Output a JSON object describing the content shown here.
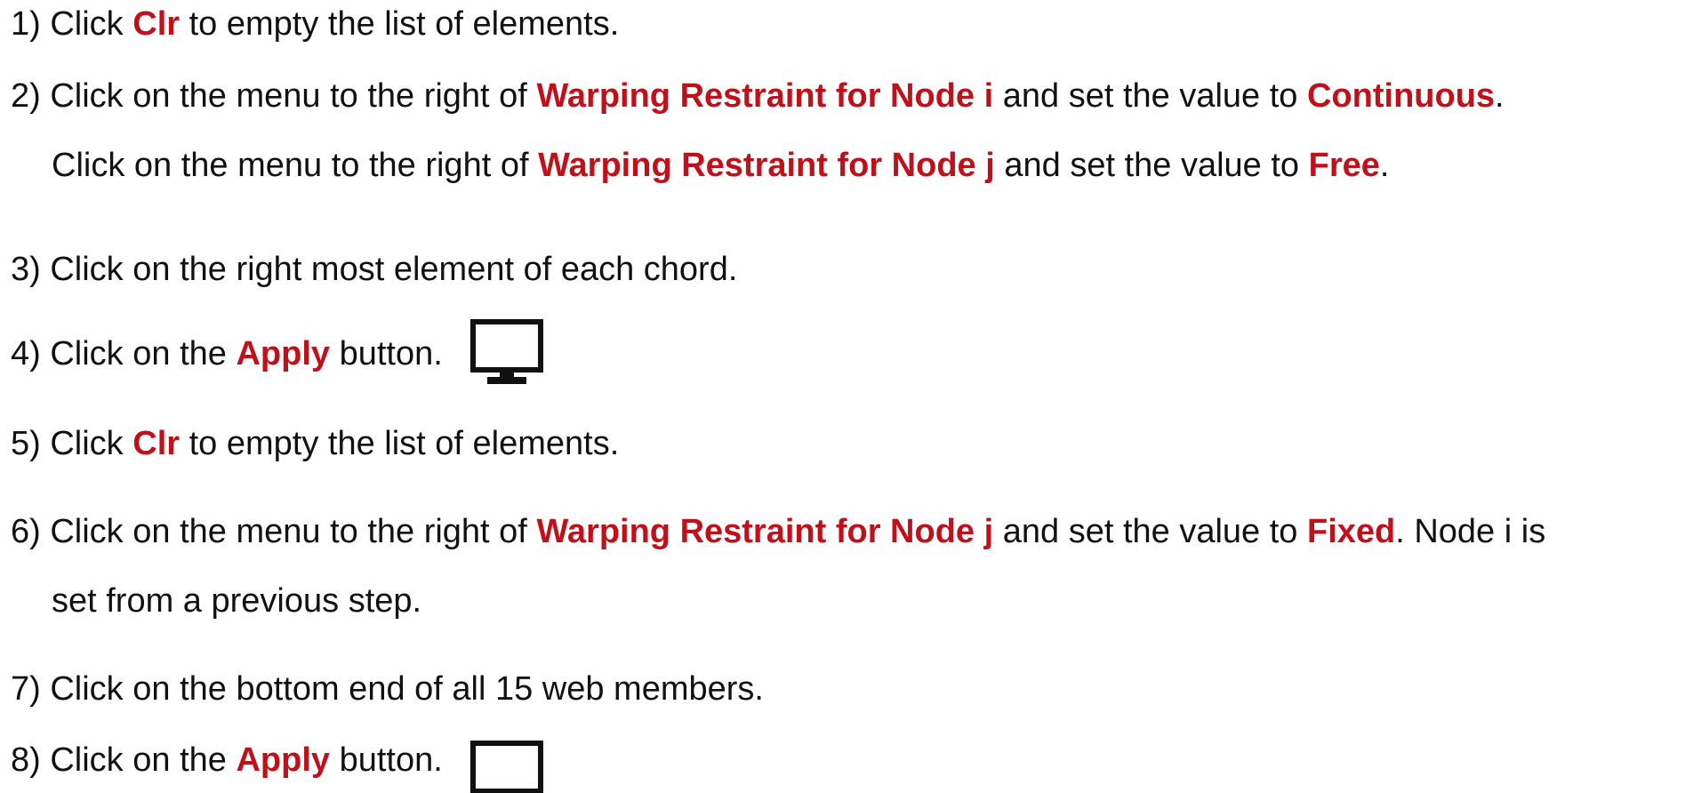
{
  "steps": [
    {
      "number": "1)",
      "segments": [
        {
          "text": "Click ",
          "bold": false
        },
        {
          "text": "Clr",
          "bold": true
        },
        {
          "text": " to empty the list of elements.",
          "bold": false
        }
      ]
    },
    {
      "number": "2)",
      "segments": [
        {
          "text": "Click on the menu to the right of ",
          "bold": false
        },
        {
          "text": "Warping Restraint for Node i",
          "bold": true
        },
        {
          "text": " and set the value to ",
          "bold": false
        },
        {
          "text": "Continuous",
          "bold": true
        },
        {
          "text": ".",
          "bold": false
        }
      ],
      "continuation": [
        {
          "text": "Click on the menu to the right of ",
          "bold": false
        },
        {
          "text": "Warping Restraint for Node j",
          "bold": true
        },
        {
          "text": " and set the value to ",
          "bold": false
        },
        {
          "text": "Free",
          "bold": true
        },
        {
          "text": ".",
          "bold": false
        }
      ]
    },
    {
      "number": "3)",
      "segments": [
        {
          "text": "Click on the right most element of each chord.",
          "bold": false
        }
      ]
    },
    {
      "number": "4)",
      "segments": [
        {
          "text": "Click on the ",
          "bold": false
        },
        {
          "text": "Apply",
          "bold": true
        },
        {
          "text": " button.",
          "bold": false
        }
      ],
      "icon": "monitor-icon"
    },
    {
      "number": "5)",
      "segments": [
        {
          "text": "Click ",
          "bold": false
        },
        {
          "text": "Clr",
          "bold": true
        },
        {
          "text": " to empty the list of elements.",
          "bold": false
        }
      ]
    },
    {
      "number": "6)",
      "segments": [
        {
          "text": "Click on the menu to the right of ",
          "bold": false
        },
        {
          "text": "Warping Restraint for Node j",
          "bold": true
        },
        {
          "text": " and set the value to ",
          "bold": false
        },
        {
          "text": "Fixed",
          "bold": true
        },
        {
          "text": ". Node i is",
          "bold": false
        }
      ],
      "continuation": [
        {
          "text": "set from a previous step.",
          "bold": false
        }
      ]
    },
    {
      "number": "7)",
      "segments": [
        {
          "text": "Click on the bottom end of all 15 web members.",
          "bold": false
        }
      ]
    },
    {
      "number": "8)",
      "segments": [
        {
          "text": "Click on the ",
          "bold": false
        },
        {
          "text": "Apply",
          "bold": true
        },
        {
          "text": " button.",
          "bold": false
        }
      ],
      "icon": "monitor-icon"
    }
  ],
  "colors": {
    "text": "#111111",
    "highlight": "#c0111b"
  }
}
